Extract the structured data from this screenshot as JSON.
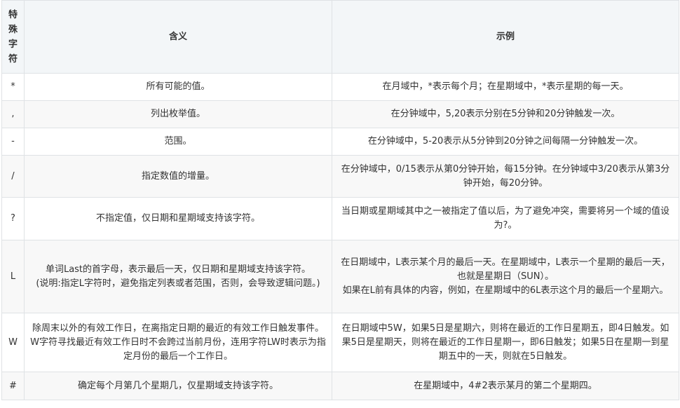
{
  "table": {
    "headers": {
      "char": "特殊字符",
      "meaning": "含义",
      "example": "示例"
    },
    "rows": [
      {
        "char": "*",
        "meaning": [
          "所有可能的值。"
        ],
        "example": [
          "在月域中，*表示每个月；在星期域中，*表示星期的每一天。"
        ]
      },
      {
        "char": ",",
        "meaning": [
          "列出枚举值。"
        ],
        "example": [
          "在分钟域中，5,20表示分别在5分钟和20分钟触发一次。"
        ]
      },
      {
        "char": "-",
        "meaning": [
          "范围。"
        ],
        "example": [
          "在分钟域中，5-20表示从5分钟到20分钟之间每隔一分钟触发一次。"
        ]
      },
      {
        "char": "/",
        "meaning": [
          "指定数值的增量。"
        ],
        "example": [
          "在分钟域中，0/15表示从第0分钟开始，每15分钟。在分钟域中3/20表示从第3分钟开始，每20分钟。"
        ]
      },
      {
        "char": "?",
        "meaning": [
          "不指定值，仅日期和星期域支持该字符。"
        ],
        "example": [
          "当日期或星期域其中之一被指定了值以后，为了避免冲突，需要将另一个域的值设为?。"
        ]
      },
      {
        "char": "L",
        "meaning": [
          "单词Last的首字母，表示最后一天，仅日期和星期域支持该字符。",
          "(说明:指定L字符时，避免指定列表或者范围，否则，会导致逻辑问题。)"
        ],
        "example": [
          "在日期域中，L表示某个月的最后一天。在星期域中，L表示一个星期的最后一天，也就是星期日（SUN）。",
          "如果在L前有具体的内容，例如，在星期域中的6L表示这个月的最后一个星期六。"
        ]
      },
      {
        "char": "W",
        "meaning": [
          "除周末以外的有效工作日，在离指定日期的最近的有效工作日触发事件。W字符寻找最近有效工作日时不会跨过当前月份，连用字符LW时表示为指定月份的最后一个工作日。"
        ],
        "example": [
          "在日期域中5W，如果5日是星期六，则将在最近的工作日星期五，即4日触发。如果5日是星期天，则将在最近的工作日星期一，即6日触发；如果5日在星期一到星期五中的一天，则就在5日触发。"
        ]
      },
      {
        "char": "#",
        "meaning": [
          "确定每个月第几个星期几，仅星期域支持该字符。"
        ],
        "example": [
          "在星期域中，4#2表示某月的第二个星期四。"
        ]
      }
    ]
  }
}
